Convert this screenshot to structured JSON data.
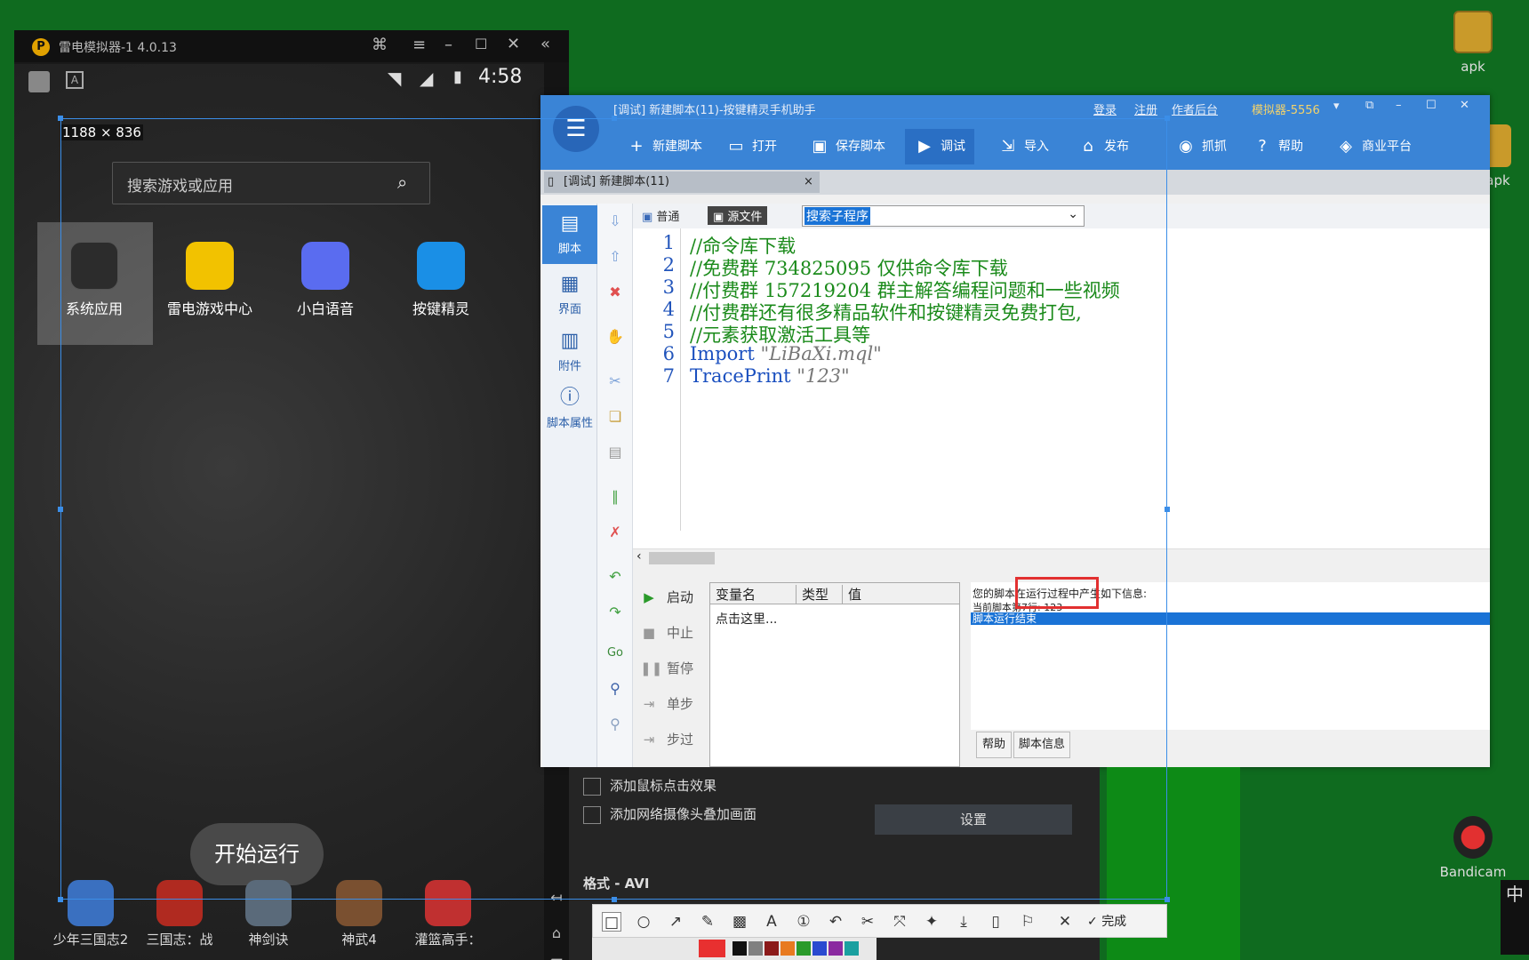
{
  "desktop": {
    "icons": [
      {
        "label": "apk",
        "color": "#c99a2a"
      },
      {
        "label": "apk",
        "color": "#c99a2a"
      },
      {
        "label": "Bandicam",
        "color": "#b01818"
      }
    ]
  },
  "emulator": {
    "title": "雷电模拟器-1 4.0.13",
    "logo": "P",
    "time": "4:58",
    "resolution": "1188 × 836",
    "search_placeholder": "搜索游戏或应用",
    "apps": [
      {
        "label": "系统应用",
        "color": "#2c2c2c"
      },
      {
        "label": "雷电游戏中心",
        "color": "#f2c200"
      },
      {
        "label": "小白语音",
        "color": "#5a6cf0"
      },
      {
        "label": "按键精灵",
        "color": "#1a8fe6"
      }
    ],
    "start_button": "开始运行",
    "dock": [
      {
        "label": "少年三国志2",
        "color": "#3a70c0"
      },
      {
        "label": "三国志：战",
        "color": "#b02a20"
      },
      {
        "label": "神剑诀",
        "color": "#5a6a7a"
      },
      {
        "label": "神武4",
        "color": "#7a5030"
      },
      {
        "label": "灌篮高手：",
        "color": "#c03030"
      }
    ]
  },
  "ide": {
    "title": "[调试] 新建脚本(11)-按键精灵手机助手",
    "title_links": [
      "登录",
      "注册",
      "作者后台"
    ],
    "emulator_select": "模拟器-5556",
    "toolbar": {
      "menu_icon": "menu-icon",
      "items": [
        "新建脚本",
        "打开",
        "保存脚本",
        "调试",
        "导入",
        "发布",
        "抓抓",
        "帮助",
        "商业平台"
      ]
    },
    "tab_label": "[调试] 新建脚本(11)",
    "left_tabs": [
      "脚本",
      "界面",
      "附件",
      "脚本属性"
    ],
    "view_normal": "普通",
    "view_source": "源文件",
    "sub_select": "搜索子程序",
    "code": [
      {
        "n": "1",
        "cls": "cm",
        "text": "//命令库下载"
      },
      {
        "n": "2",
        "cls": "cm",
        "text": "//免费群 734825095 仅供命令库下载"
      },
      {
        "n": "3",
        "cls": "cm",
        "text": "//付费群 157219204 群主解答编程问题和一些视频"
      },
      {
        "n": "4",
        "cls": "cm",
        "text": "//付费群还有很多精品软件和按键精灵免费打包,"
      },
      {
        "n": "5",
        "cls": "cm",
        "text": "//元素获取激活工具等"
      },
      {
        "n": "6",
        "kw": "Import",
        "str": "\"LiBaXi.mql\""
      },
      {
        "n": "7",
        "kw": "TracePrint",
        "str": "\"123\""
      }
    ],
    "debug_buttons": [
      "启动",
      "中止",
      "暂停",
      "单步",
      "步过"
    ],
    "vars_headers": [
      "变量名",
      "类型",
      "值"
    ],
    "vars_placeholder": "点击这里...",
    "info_text": "您的脚本在运行过程中产生如下信息:",
    "info_line2": "当前脚本第7行: 123",
    "info_selected": "脚本运行结束",
    "info_tabs": [
      "帮助",
      "脚本信息"
    ]
  },
  "recorder": {
    "checkbox1": "添加鼠标点击效果",
    "checkbox2": "添加网络摄像头叠加画面",
    "settings_button": "设置",
    "format_label": "格式 - AVI"
  },
  "annotate": {
    "done": "完成",
    "colors": [
      "#e83030",
      "#111111",
      "#808080",
      "#8b1a1a",
      "#e87a20",
      "#2a9a2a",
      "#2a4ad0",
      "#8a2aa0",
      "#1aa0a0"
    ]
  },
  "ime": "中"
}
